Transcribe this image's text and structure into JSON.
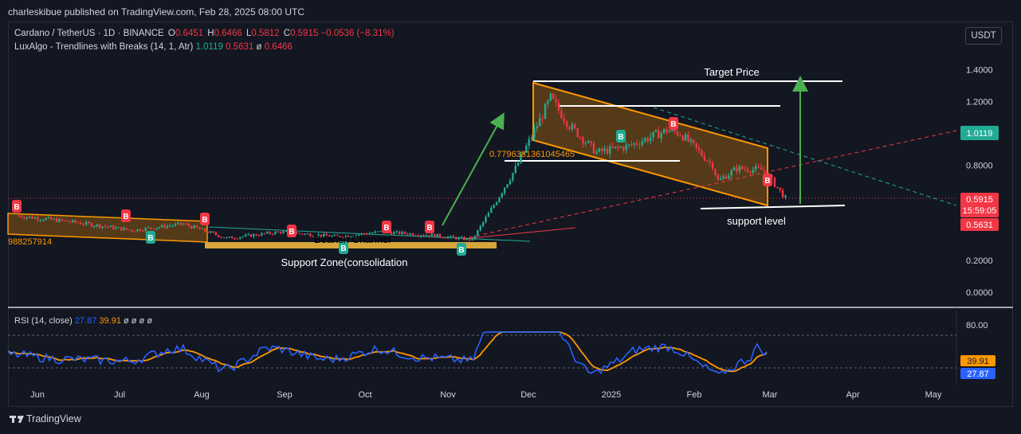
{
  "publisher": "charleskibue published on TradingView.com, Feb 28, 2025 08:00 UTC",
  "legend": {
    "symbol": "Cardano / TetherUS · 1D · BINANCE",
    "o_label": "O",
    "o_value": "0.6451",
    "h_label": "H",
    "h_value": "0.6466",
    "l_label": "L",
    "l_value": "0.5812",
    "c_label": "C",
    "c_value": "0.5915",
    "change": "−0.0536 (−8.31%)",
    "indicator": "LuxAlgo - Trendlines with Breaks (14, 1, Atr)",
    "ind_v1": "1.0119",
    "ind_v2": "0.5631",
    "ind_v3": "ø",
    "ind_v4": "0.6466"
  },
  "currency": "USDT",
  "annotations": {
    "target_price": "Target Price",
    "support_level": "support level",
    "support_zone": "Support Zone(consolidation",
    "bearish_channel": "Bearish Channel",
    "fib_value": "0.7796381361045465",
    "left_value": "988257914"
  },
  "price_badges": {
    "indicator_value": "1.0119",
    "close": "0.5915",
    "countdown": "15:59:05",
    "support": "0.5631"
  },
  "rsi": {
    "title": "RSI (14, close)",
    "rsi_value": "27.87",
    "ma_value": "39.91",
    "extra": "ø ø ø ø",
    "axis_label": "80.00"
  },
  "footer": {
    "brand": "TradingView"
  },
  "colors": {
    "bg": "#131722",
    "up": "#22ab94",
    "down": "#f23645",
    "rsi": "#2962ff",
    "rsi_ma": "#ff9800",
    "channel": "#ff9800",
    "arrow": "#4caf50"
  },
  "chart_data": [
    {
      "type": "candlestick",
      "title": "Cardano / TetherUS · 1D · BINANCE",
      "x_tick_labels": [
        "Jun",
        "Jul",
        "Aug",
        "Sep",
        "Oct",
        "Nov",
        "Dec",
        "2025",
        "Feb",
        "Mar",
        "Apr",
        "May"
      ],
      "y_tick_labels": [
        "1.4000",
        "1.2000",
        "0.8000",
        "0.2000",
        "0.0000"
      ],
      "ylim": [
        -0.05,
        1.55
      ],
      "close_path": [
        {
          "date": "2024-05-20",
          "close": 0.48
        },
        {
          "date": "2024-06-10",
          "close": 0.44
        },
        {
          "date": "2024-07-01",
          "close": 0.39
        },
        {
          "date": "2024-07-20",
          "close": 0.43
        },
        {
          "date": "2024-08-05",
          "close": 0.34
        },
        {
          "date": "2024-08-25",
          "close": 0.38
        },
        {
          "date": "2024-09-15",
          "close": 0.35
        },
        {
          "date": "2024-10-01",
          "close": 0.38
        },
        {
          "date": "2024-10-20",
          "close": 0.36
        },
        {
          "date": "2024-11-04",
          "close": 0.33
        },
        {
          "date": "2024-11-12",
          "close": 0.55
        },
        {
          "date": "2024-11-20",
          "close": 0.78
        },
        {
          "date": "2024-11-28",
          "close": 1.05
        },
        {
          "date": "2024-12-03",
          "close": 1.22
        },
        {
          "date": "2024-12-10",
          "close": 1.05
        },
        {
          "date": "2024-12-20",
          "close": 0.88
        },
        {
          "date": "2025-01-01",
          "close": 0.92
        },
        {
          "date": "2025-01-15",
          "close": 1.02
        },
        {
          "date": "2025-01-20",
          "close": 1.0
        },
        {
          "date": "2025-02-01",
          "close": 0.8
        },
        {
          "date": "2025-02-03",
          "close": 0.7
        },
        {
          "date": "2025-02-10",
          "close": 0.78
        },
        {
          "date": "2025-02-20",
          "close": 0.77
        },
        {
          "date": "2025-02-28",
          "close": 0.5915
        }
      ],
      "levels": {
        "target_price": 1.33,
        "resistance": 1.18,
        "fib": 0.78,
        "support": 0.55
      }
    },
    {
      "type": "line",
      "title": "RSI (14, close)",
      "series": [
        {
          "name": "RSI",
          "last": 27.87
        },
        {
          "name": "MA",
          "last": 39.91
        }
      ],
      "y_tick_labels": [
        "80.00"
      ]
    }
  ]
}
